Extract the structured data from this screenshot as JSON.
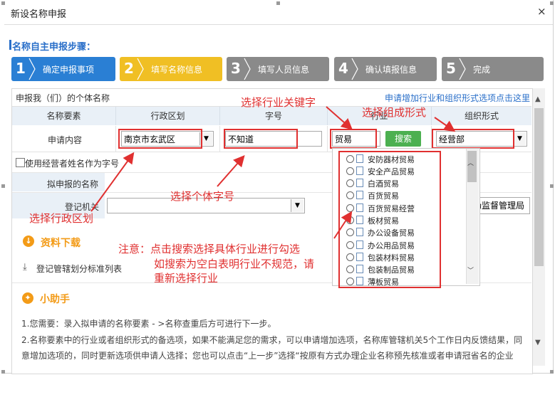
{
  "dialog": {
    "title": "新设名称申报",
    "close_label": "×"
  },
  "steps_heading": "名称自主申报步骤：",
  "steps": [
    {
      "num": "1",
      "label": "确定申报事项",
      "color": "#2a7fd4"
    },
    {
      "num": "2",
      "label": "填写名称信息",
      "color": "#f0bf24"
    },
    {
      "num": "3",
      "label": "填写人员信息",
      "color": "#8a8a8a"
    },
    {
      "num": "4",
      "label": "确认填报信息",
      "color": "#8a8a8a"
    },
    {
      "num": "5",
      "label": "完成",
      "color": "#8a8a8a"
    }
  ],
  "form": {
    "section_label": "申报我（们）的个体名称",
    "apply_link": "申请增加行业和组织形式选项点击这里",
    "headers": {
      "elements": "名称要素",
      "district": "行政区划",
      "word": "字号",
      "industry": "行业",
      "org_form": "组织形式"
    },
    "row_label": "申请内容",
    "district_value": "南京市玄武区",
    "word_value": "不知道",
    "industry_value": "贸易",
    "search_label": "搜索",
    "org_form_value": "经营部",
    "use_name_checkbox": "使用经营者姓名作为字号",
    "proposed_name_label": "拟申报的名称",
    "registry_label": "登记机关",
    "registry_value": "场监督管理局"
  },
  "industry_options": [
    "安防器材贸易",
    "安全产品贸易",
    "白酒贸易",
    "百货贸易",
    "百货贸易经营",
    "板材贸易",
    "办公设备贸易",
    "办公用品贸易",
    "包装材料贸易",
    "包装制品贸易",
    "薄板贸易"
  ],
  "downloads": {
    "title": "资料下载",
    "link": "登记管辖划分标准列表"
  },
  "helper": {
    "title": "小助手",
    "line1": "1.您需要：录入拟申请的名称要素 - >名称查重后方可进行下一步。",
    "line2": "2.名称要素中的行业或者组织形式的备选项，如果不能满足您的需求，可以申请增加选项，名称库管辖机关5个工作日内反馈结果，同",
    "line3": "意增加选项的，同时更新选项供申请人选择；您也可以点击“上一步”选择“按原有方式办理企业名称预先核准或者申请冠省名的企业"
  },
  "annotations": {
    "industry_keyword": "选择行业关键字",
    "org_form": "选择组成形式",
    "word": "选择个体字号",
    "district": "选择行政区划",
    "note_line1": "注意：点击搜索选择具体行业进行勾选",
    "note_line2": "如搜索为空白表明行业不规范，请",
    "note_line3": "重新选择行业"
  },
  "colors": {
    "annotation_red": "#e03030",
    "accent_blue": "#2a6fc9",
    "orange": "#f39b17",
    "search_green": "#4cb050"
  }
}
